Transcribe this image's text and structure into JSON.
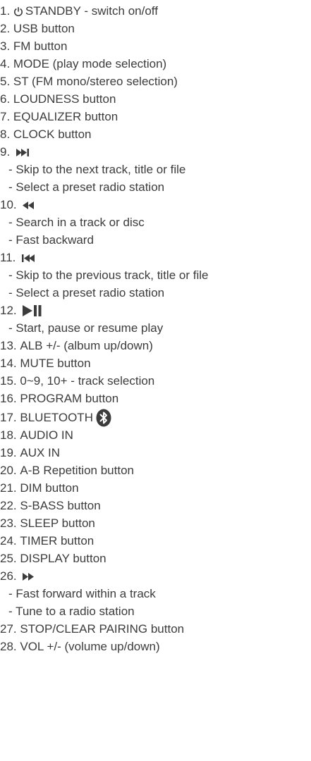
{
  "items": [
    {
      "number": "1.",
      "text": "STANDBY - switch on/off",
      "icon": "power-icon"
    },
    {
      "number": "2.",
      "text": "USB button"
    },
    {
      "number": "3.",
      "text": "FM button"
    },
    {
      "number": "4.",
      "text": "MODE (play mode selection)"
    },
    {
      "number": "5.",
      "text": "ST (FM mono/stereo selection)"
    },
    {
      "number": "6.",
      "text": "LOUDNESS button"
    },
    {
      "number": "7.",
      "text": "EQUALIZER button"
    },
    {
      "number": "8.",
      "text": "CLOCK button"
    },
    {
      "number": "9.",
      "icon": "next-track-icon",
      "details": [
        "- Skip to the next track, title or file",
        "- Select a preset radio station"
      ]
    },
    {
      "number": "10.",
      "icon": "rewind-icon",
      "details": [
        "- Search in a track or disc",
        "- Fast backward"
      ]
    },
    {
      "number": "11.",
      "icon": "previous-track-icon",
      "details": [
        "- Skip to the previous track, title or file",
        "- Select a preset radio station"
      ]
    },
    {
      "number": "12.",
      "icon": "play-pause-icon",
      "details": [
        "- Start, pause or resume play"
      ]
    },
    {
      "number": "13.",
      "text": "ALB +/- (album up/down)"
    },
    {
      "number": "14.",
      "text": "MUTE button"
    },
    {
      "number": "15.",
      "text": "0~9, 10+ - track selection"
    },
    {
      "number": "16.",
      "text": "PROGRAM button"
    },
    {
      "number": "17.",
      "text": "BLUETOOTH",
      "icon": "bluetooth-icon"
    },
    {
      "number": "18.",
      "text": "AUDIO IN"
    },
    {
      "number": "19.",
      "text": "AUX IN"
    },
    {
      "number": "20.",
      "text": "A-B Repetition button"
    },
    {
      "number": "21.",
      "text": "DIM button"
    },
    {
      "number": "22.",
      "text": "S-BASS button"
    },
    {
      "number": "23.",
      "text": "SLEEP button"
    },
    {
      "number": "24.",
      "text": "TIMER button"
    },
    {
      "number": "25.",
      "text": "DISPLAY button"
    },
    {
      "number": "26.",
      "icon": "fast-forward-icon",
      "details": [
        "- Fast forward within a track",
        "- Tune to a radio station"
      ]
    },
    {
      "number": "27.",
      "text": "STOP/CLEAR PAIRING button"
    },
    {
      "number": "28.",
      "text": "VOL +/- (volume up/down)"
    }
  ]
}
